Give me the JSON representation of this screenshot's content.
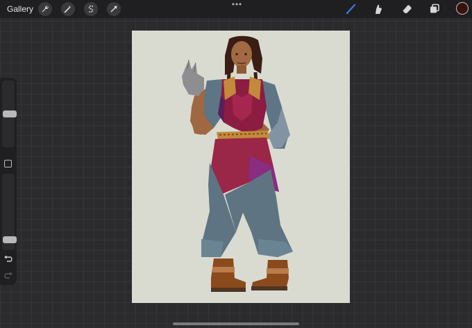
{
  "topbar": {
    "gallery_label": "Gallery",
    "actions_icon": "wrench-icon",
    "adjustments_icon": "magic-wand-icon",
    "selection_icon": "selection-s-icon",
    "transform_icon": "arrow-cursor-icon",
    "more_icon": "more-dots-icon",
    "brush_icon": "brush-icon",
    "smudge_icon": "smudge-finger-icon",
    "eraser_icon": "eraser-icon",
    "layers_icon": "layers-icon",
    "active_color": "#3a120d",
    "brush_color": "#3d7bd9"
  },
  "sidebar": {
    "brush_size_level": 0.5,
    "opacity_level": 0.1,
    "modify_icon": "square-modify-icon",
    "undo_icon": "undo-icon",
    "redo_icon": "redo-icon"
  },
  "canvas": {
    "background": "#d9dbd1",
    "artwork": "character-illustration"
  }
}
